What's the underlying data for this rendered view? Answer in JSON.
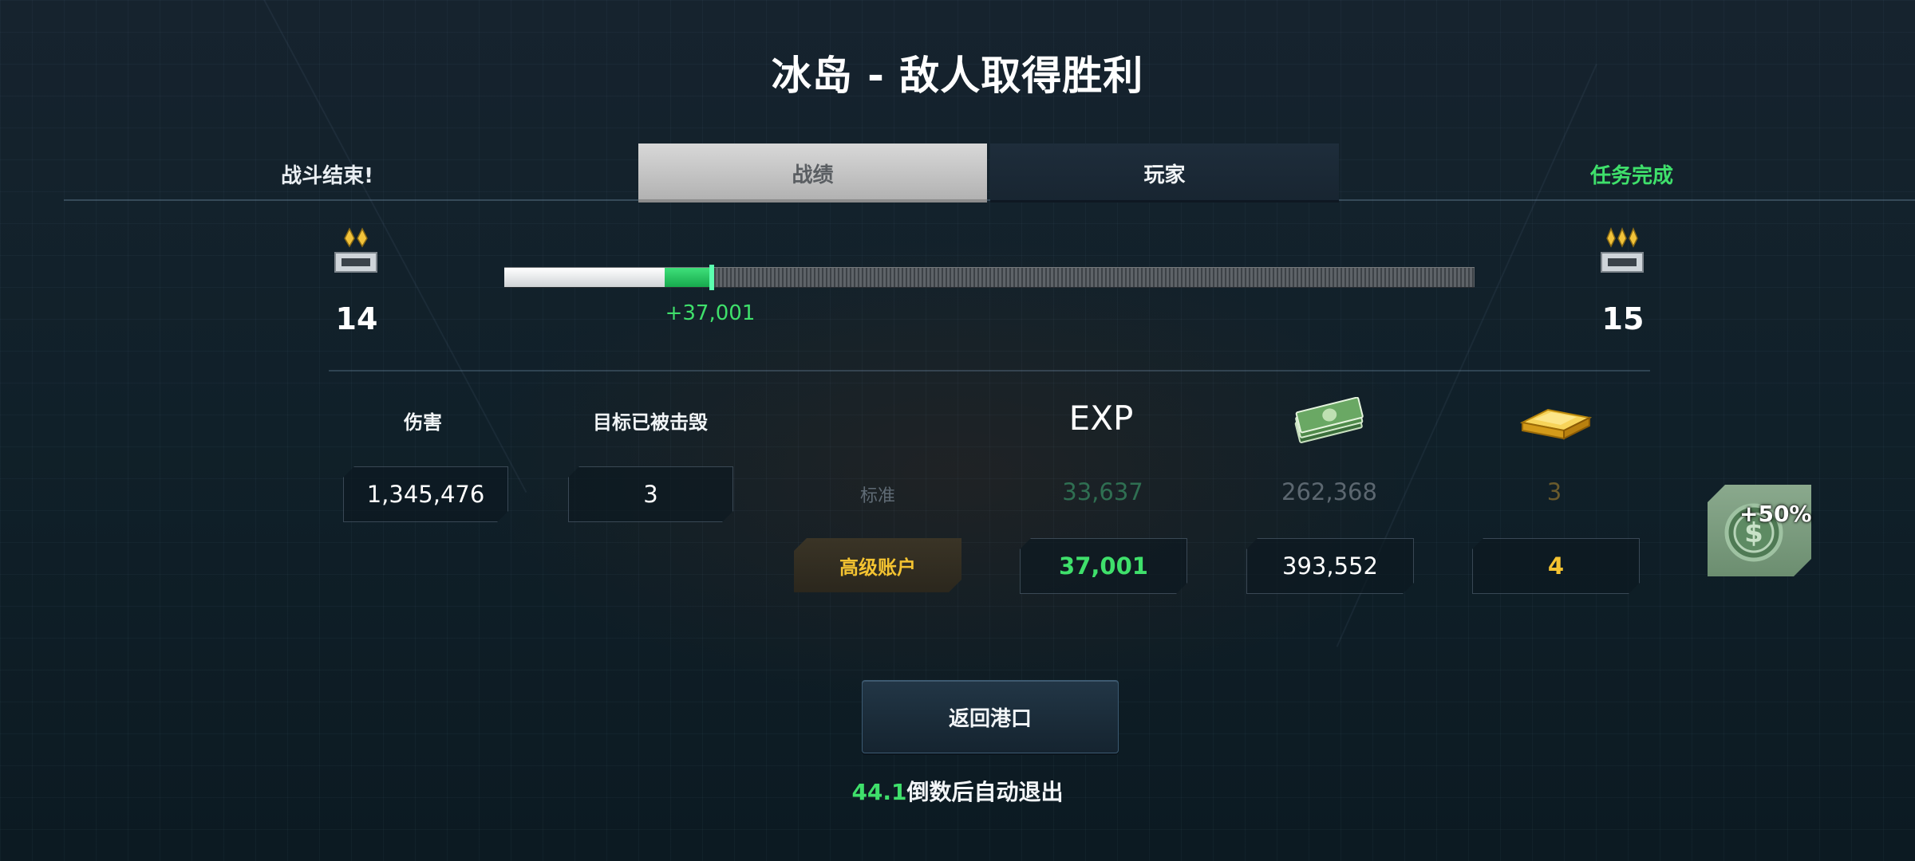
{
  "title": "冰岛 - 敌人取得胜利",
  "header": {
    "battle_status": "战斗结束!",
    "mission_status": "任务完成",
    "tabs": [
      {
        "label": "战绩",
        "active": true
      },
      {
        "label": "玩家",
        "active": false
      }
    ]
  },
  "rank": {
    "current": "14",
    "next": "15",
    "progress_before": 0.165,
    "progress_after": 0.214,
    "gain": "+37,001"
  },
  "stats": {
    "damage_label": "伤害",
    "damage_value": "1,345,476",
    "destroyed_label": "目标已被击毁",
    "destroyed_value": "3"
  },
  "rewards": {
    "exp_label": "EXP",
    "standard_label": "标准",
    "premium_label": "高级账户",
    "standard": {
      "exp": "33,637",
      "credits": "262,368",
      "gold": "3"
    },
    "premium": {
      "exp": "37,001",
      "credits": "393,552",
      "gold": "4"
    },
    "bonus": "+50%"
  },
  "actions": {
    "return_label": "返回港口",
    "countdown_value": "44.1",
    "countdown_text": "倒数后自动退出"
  },
  "colors": {
    "accent_green": "#3fe06b",
    "gold": "#f4c331",
    "standard_exp": "#2f6f52",
    "standard_credits": "#5c6770",
    "standard_gold": "#6a5a2c"
  }
}
